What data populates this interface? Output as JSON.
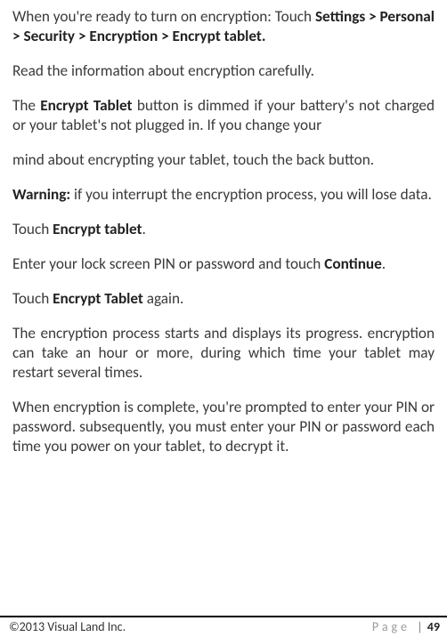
{
  "paragraphs": {
    "p1a": "When you're ready to turn on encryption: Touch ",
    "p1b": "Settings > Personal > Security > Encryption > Encrypt tablet.",
    "p2": "Read the information about encryption carefully.",
    "p3a": "The ",
    "p3b": "Encrypt Tablet",
    "p3c": " button is dimmed if your battery's not charged or your tablet's not plugged in. If you change your",
    "p4": "mind about encrypting your tablet, touch the back button.",
    "p5a": "Warning:",
    "p5b": " if you interrupt the encryption process, you will lose data.",
    "p6a": "Touch ",
    "p6b": "Encrypt tablet",
    "p6c": ".",
    "p7a": "Enter your lock screen PIN or password and touch ",
    "p7b": "Continue",
    "p7c": ".",
    "p8a": "Touch ",
    "p8b": "Encrypt Tablet",
    "p8c": " again.",
    "p9": "The encryption process starts and displays its progress. encryption can take an hour or more, during which time your tablet may restart several times.",
    "p10": "When encryption is complete, you're prompted to enter your PIN or password. subsequently, you must enter your PIN or password each time you power on your tablet, to decrypt it."
  },
  "footer": {
    "copyright": "©2013 Visual Land Inc.",
    "page_label": "Page",
    "separator": "|",
    "page_number": "49"
  }
}
